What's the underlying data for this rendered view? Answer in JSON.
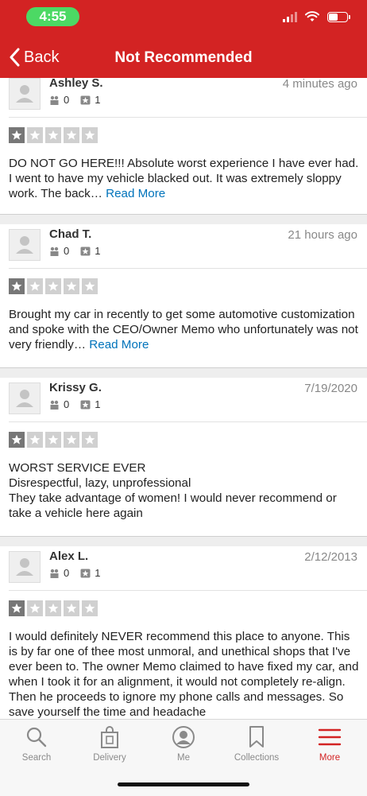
{
  "status_bar": {
    "time": "4:55"
  },
  "nav": {
    "back_label": "Back",
    "title": "Not Recommended"
  },
  "colors": {
    "brand": "#d32323",
    "link": "#0073bb",
    "status_pill": "#4cd964"
  },
  "reviews": [
    {
      "name": "Ashley S.",
      "date": "4 minutes ago",
      "friends": "0",
      "reviews": "1",
      "rating": 1,
      "text": "DO NOT GO HERE!!! Absolute worst experience I have ever had. I went to have my vehicle blacked out. It was extremely sloppy work. The back… ",
      "read_more": "Read More"
    },
    {
      "name": "Chad T.",
      "date": "21 hours ago",
      "friends": "0",
      "reviews": "1",
      "rating": 1,
      "text": "Brought my car in recently to get some automotive customization and spoke with the CEO/Owner Memo who unfortunately was not very friendly… ",
      "read_more": "Read More"
    },
    {
      "name": "Krissy G.",
      "date": "7/19/2020",
      "friends": "0",
      "reviews": "1",
      "rating": 1,
      "text": "WORST SERVICE EVER\nDisrespectful, lazy, unprofessional\nThey take advantage of women!  I would never recommend or take a vehicle here again",
      "read_more": ""
    },
    {
      "name": "Alex L.",
      "date": "2/12/2013",
      "friends": "0",
      "reviews": "1",
      "rating": 1,
      "text": "I would definitely NEVER recommend this place to anyone. This is by far one of thee most unmoral, and unethical shops that I've ever been to. The owner Memo claimed to have fixed my car, and when I took it for an alignment, it would not completely re-align. Then he proceeds to ignore my phone calls and messages. So save yourself the time and headache",
      "read_more": ""
    }
  ],
  "tabbar": {
    "tabs": [
      {
        "label": "Search",
        "icon": "search-icon"
      },
      {
        "label": "Delivery",
        "icon": "shopping-bag-icon"
      },
      {
        "label": "Me",
        "icon": "profile-icon"
      },
      {
        "label": "Collections",
        "icon": "bookmark-icon"
      },
      {
        "label": "More",
        "icon": "hamburger-menu-icon",
        "active": true
      }
    ]
  }
}
